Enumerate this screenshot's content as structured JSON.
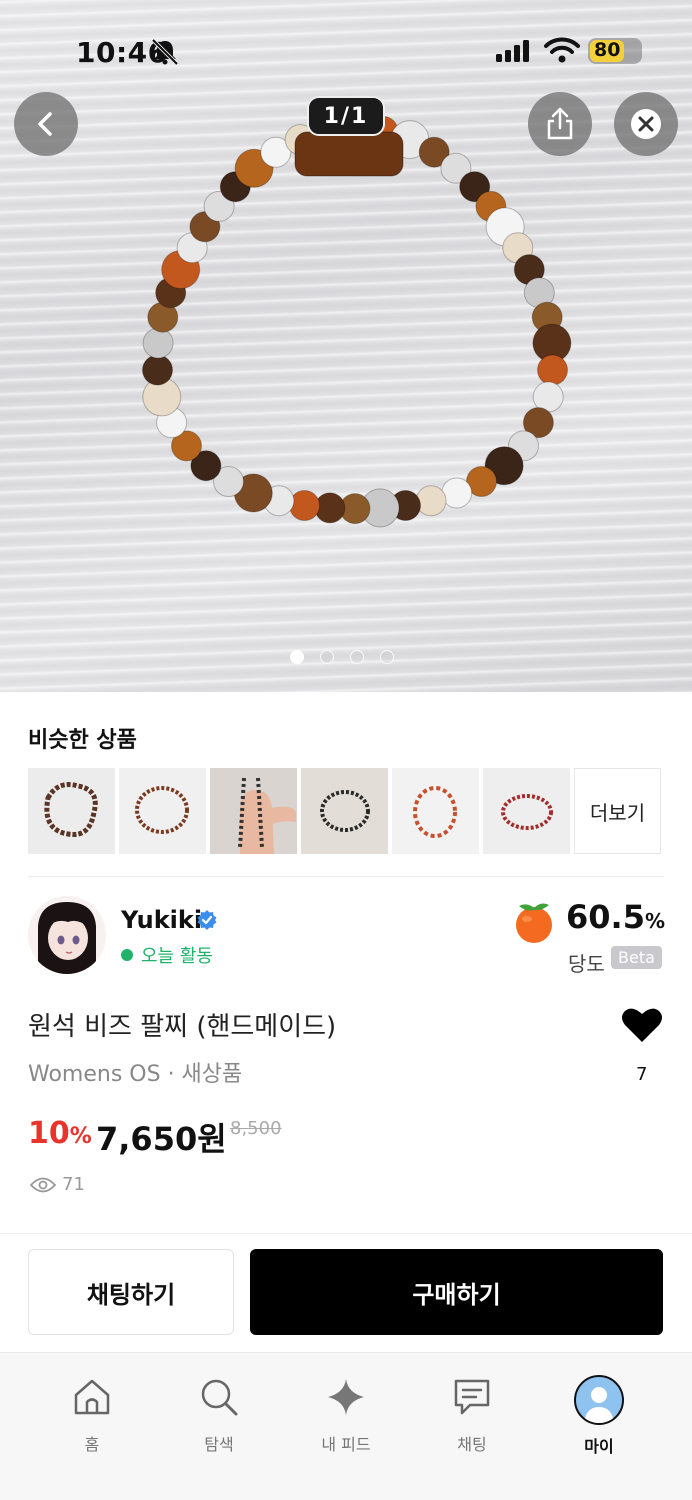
{
  "status_bar": {
    "time": "10:46",
    "battery": "80"
  },
  "gallery": {
    "counter": "1/1",
    "dots": 4,
    "active_dot": 0
  },
  "similar": {
    "title": "비슷한 상품",
    "more_label": "더보기",
    "thumb_count": 6
  },
  "seller": {
    "name": "Yukiki",
    "status": "오늘 활동",
    "sweetness_value": "60.5",
    "sweetness_unit": "%",
    "sweetness_label": "당도",
    "beta": "Beta"
  },
  "product": {
    "title": "원석 비즈 팔찌 (핸드메이드)",
    "subtitle": "Womens OS · 새상품",
    "likes": "7",
    "discount": "10",
    "discount_unit": "%",
    "price": "7,650원",
    "original_price": "8,500",
    "views": "71"
  },
  "actions": {
    "chat": "채팅하기",
    "buy": "구매하기"
  },
  "nav": {
    "home": "홈",
    "search": "탐색",
    "feed": "내 피드",
    "chat": "채팅",
    "my": "마이"
  },
  "colors": {
    "discount": "#e8352b",
    "online": "#1fb36a",
    "primary": "#000000"
  }
}
